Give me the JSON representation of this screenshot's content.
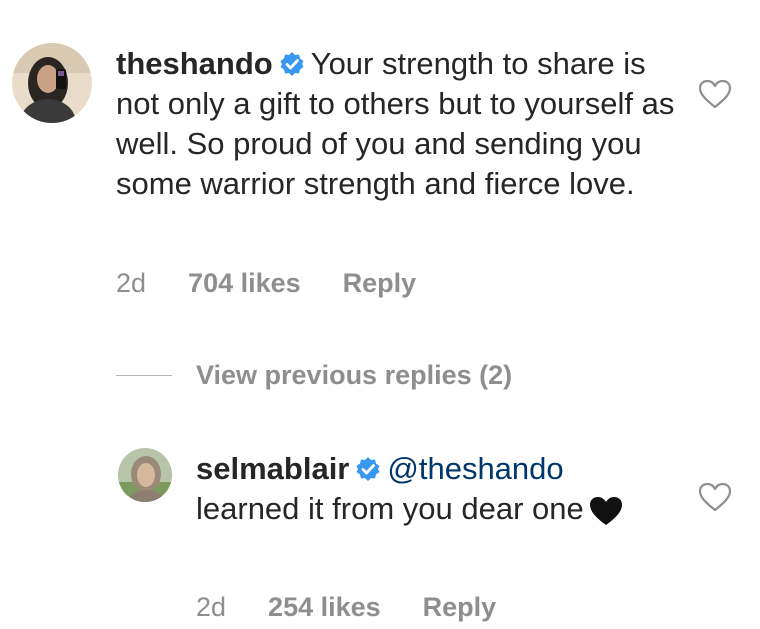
{
  "comments": [
    {
      "username": "theshando",
      "verified": true,
      "text": "Your strength to share is not only a gift to others but to yourself as well. So proud of you and sending you some warrior strength and fierce love.",
      "time": "2d",
      "likes": "704 likes",
      "reply_label": "Reply"
    },
    {
      "username": "selmablair",
      "verified": true,
      "mention": "@theshando",
      "text": "learned it from you dear one",
      "emoji": "black-heart",
      "time": "2d",
      "likes": "254 likes",
      "reply_label": "Reply"
    }
  ],
  "view_replies": {
    "label": "View previous replies (2)"
  },
  "colors": {
    "text": "#262626",
    "meta": "#8e8e8e",
    "verified_badge": "#3897f0",
    "mention": "#00376b"
  },
  "icons": {
    "verified": "verified-badge-icon",
    "like": "heart-outline-icon",
    "emoji": "black-heart-emoji-icon"
  }
}
